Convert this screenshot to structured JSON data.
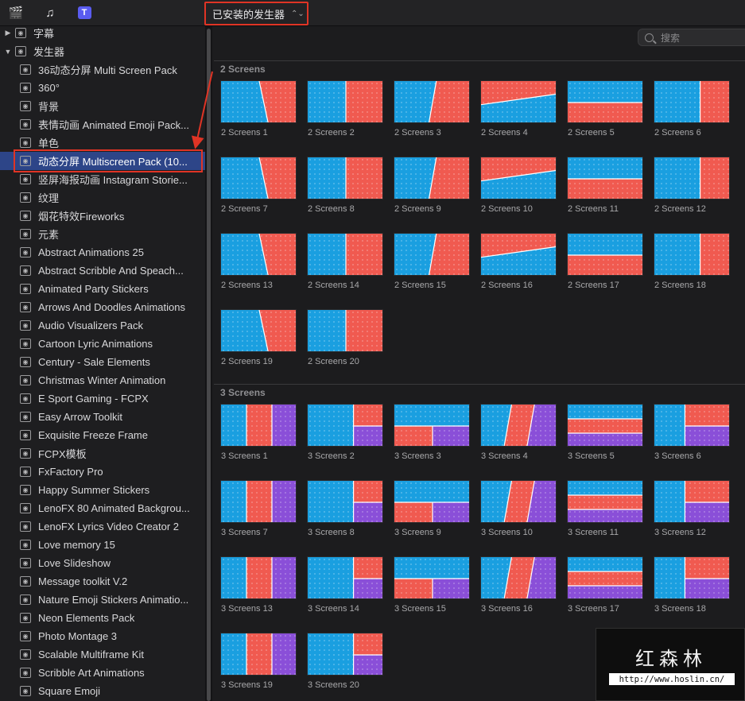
{
  "toolbar": {
    "icons": [
      "clapperboard-star-icon",
      "music-note-icon",
      "title-t-icon"
    ],
    "selector_label": "已安装的发生器",
    "search_placeholder": "搜索"
  },
  "sidebar": {
    "items": [
      {
        "label": "字幕",
        "level": "top",
        "expanded": false
      },
      {
        "label": "发生器",
        "level": "top",
        "expanded": true
      },
      {
        "label": "36动态分屏 Multi Screen Pack",
        "level": "child"
      },
      {
        "label": "360°",
        "level": "child"
      },
      {
        "label": "背景",
        "level": "child"
      },
      {
        "label": "表情动画 Animated Emoji Pack...",
        "level": "child"
      },
      {
        "label": "单色",
        "level": "child"
      },
      {
        "label": "动态分屏 Multiscreen Pack (10...",
        "level": "child",
        "selected": true
      },
      {
        "label": "竖屏海报动画 Instagram Storie...",
        "level": "child"
      },
      {
        "label": "纹理",
        "level": "child"
      },
      {
        "label": "烟花特效Fireworks",
        "level": "child"
      },
      {
        "label": "元素",
        "level": "child"
      },
      {
        "label": "Abstract Animations 25",
        "level": "child"
      },
      {
        "label": "Abstract Scribble And Speach...",
        "level": "child"
      },
      {
        "label": "Animated Party Stickers",
        "level": "child"
      },
      {
        "label": "Arrows And Doodles Animations",
        "level": "child"
      },
      {
        "label": "Audio Visualizers Pack",
        "level": "child"
      },
      {
        "label": "Cartoon Lyric Animations",
        "level": "child"
      },
      {
        "label": "Century - Sale Elements",
        "level": "child"
      },
      {
        "label": "Christmas Winter Animation",
        "level": "child"
      },
      {
        "label": "E Sport Gaming - FCPX",
        "level": "child"
      },
      {
        "label": "Easy Arrow Toolkit",
        "level": "child"
      },
      {
        "label": "Exquisite Freeze Frame",
        "level": "child"
      },
      {
        "label": "FCPX模板",
        "level": "child"
      },
      {
        "label": "FxFactory Pro",
        "level": "child"
      },
      {
        "label": "Happy Summer Stickers",
        "level": "child"
      },
      {
        "label": "LenoFX 80 Animated Backgrou...",
        "level": "child"
      },
      {
        "label": "LenoFX Lyrics Video Creator 2",
        "level": "child"
      },
      {
        "label": "Love memory 15",
        "level": "child"
      },
      {
        "label": "Love Slideshow",
        "level": "child"
      },
      {
        "label": "Message toolkit V.2",
        "level": "child"
      },
      {
        "label": "Nature Emoji Stickers Animatio...",
        "level": "child"
      },
      {
        "label": "Neon Elements Pack",
        "level": "child"
      },
      {
        "label": "Photo Montage 3",
        "level": "child"
      },
      {
        "label": "Scalable Multiframe Kit",
        "level": "child"
      },
      {
        "label": "Scribble Art Animations",
        "level": "child"
      },
      {
        "label": "Square Emoji",
        "level": "child"
      }
    ]
  },
  "sections": [
    {
      "header": "2 Screens",
      "items": [
        "2 Screens 1",
        "2 Screens 2",
        "2 Screens 3",
        "2 Screens 4",
        "2 Screens 5",
        "2 Screens 6",
        "2 Screens 7",
        "2 Screens 8",
        "2 Screens 9",
        "2 Screens 10",
        "2 Screens 11",
        "2 Screens 12",
        "2 Screens 13",
        "2 Screens 14",
        "2 Screens 15",
        "2 Screens 16",
        "2 Screens 17",
        "2 Screens 18",
        "2 Screens 19",
        "2 Screens 20"
      ]
    },
    {
      "header": "3 Screens",
      "items": [
        "3 Screens 1",
        "3 Screens 2",
        "3 Screens 3",
        "3 Screens 4",
        "3 Screens 5",
        "3 Screens 6",
        "3 Screens 7",
        "3 Screens 8",
        "3 Screens 9",
        "3 Screens 10",
        "3 Screens 11",
        "3 Screens 12",
        "3 Screens 13",
        "3 Screens 14",
        "3 Screens 15",
        "3 Screens 16",
        "3 Screens 17",
        "3 Screens 18",
        "3 Screens 19",
        "3 Screens 20"
      ]
    }
  ],
  "watermark": {
    "title": "红森林",
    "url": "http://www.hoslin.cn/"
  },
  "colors": {
    "blue_panel": "#1a9fe0",
    "red_panel": "#f05a50",
    "orange_panel": "#f7824a",
    "purple_panel": "#8a4fd8",
    "selection": "#2d4588",
    "highlight_border": "#e03425"
  }
}
